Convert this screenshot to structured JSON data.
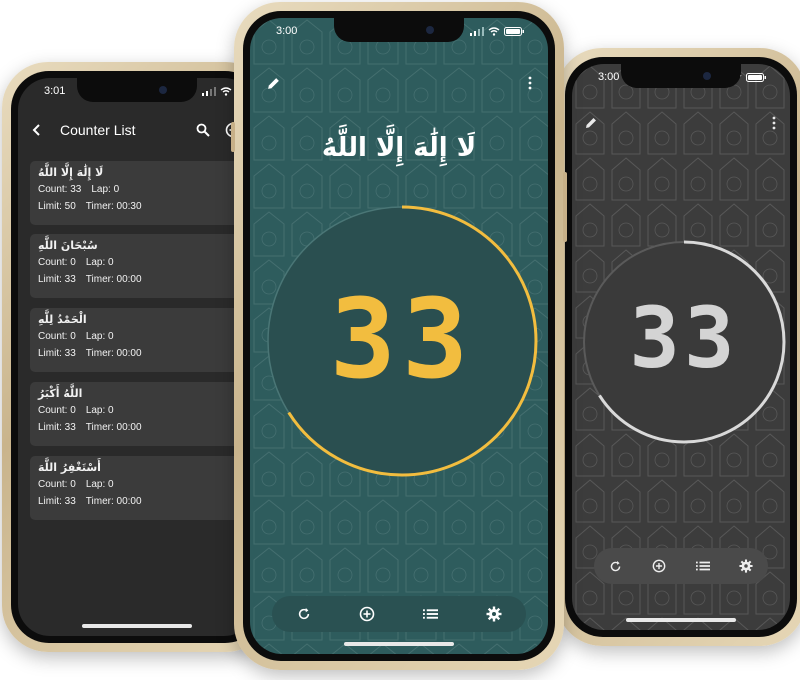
{
  "phones": {
    "list": {
      "time": "3:01",
      "title": "Counter List",
      "items": [
        {
          "arabic": "لَا إِلَٰهَ إِلَّا اللَّهُ",
          "count": "Count: 33",
          "lap": "Lap: 0",
          "limit": "Limit: 50",
          "timer": "Timer: 00:30",
          "action_icon": "check-circle-icon"
        },
        {
          "arabic": "سُبْحَانَ اللَّهِ",
          "count": "Count: 0",
          "lap": "Lap: 0",
          "limit": "Limit: 33",
          "timer": "Timer: 00:00",
          "action_icon": "trash-icon"
        },
        {
          "arabic": "الْحَمْدُ لِلَّهِ",
          "count": "Count: 0",
          "lap": "Lap: 0",
          "limit": "Limit: 33",
          "timer": "Timer: 00:00",
          "action_icon": "trash-icon"
        },
        {
          "arabic": "اللَّهُ أَكْبَرُ",
          "count": "Count: 0",
          "lap": "Lap: 0",
          "limit": "Limit: 33",
          "timer": "Timer: 00:00",
          "action_icon": "trash-icon"
        },
        {
          "arabic": "أَسْتَغْفِرُ اللَّهَ",
          "count": "Count: 0",
          "lap": "Lap: 0",
          "limit": "Limit: 33",
          "timer": "Timer: 00:00",
          "action_icon": "trash-icon"
        }
      ]
    },
    "main": {
      "time": "3:00",
      "arabic": "لَا إِلَٰهَ إِلَّا اللَّهُ",
      "count": "33",
      "progress": 0.66,
      "accent": "#f2bd3f",
      "background": "#2e5c5d"
    },
    "dark": {
      "time": "3:00",
      "count": "33",
      "progress": 0.66,
      "accent": "#d9d9d9",
      "background": "#3c3c3c"
    }
  }
}
